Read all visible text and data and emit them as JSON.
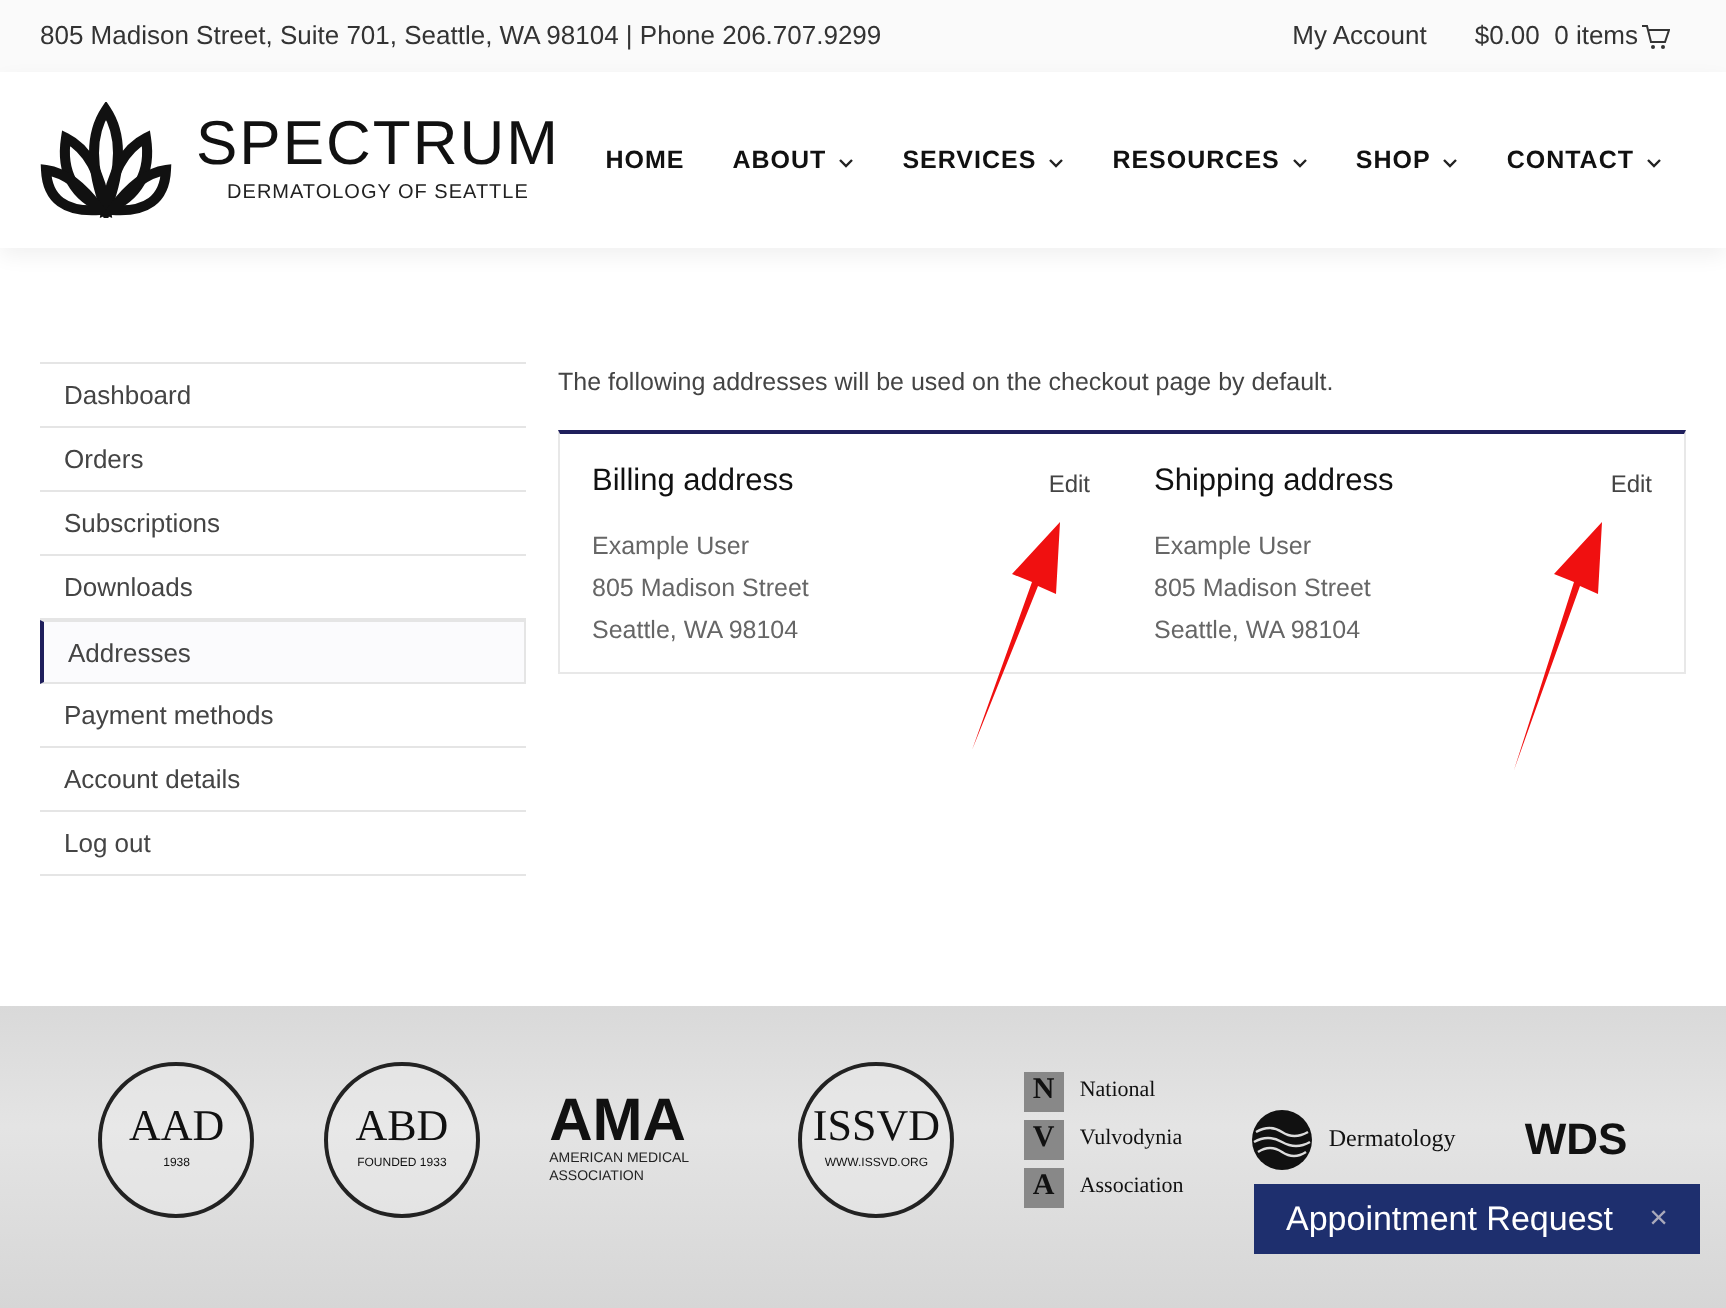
{
  "topbar": {
    "address": "805 Madison Street, Suite 701, Seattle, WA 98104 | Phone 206.707.9299",
    "account": "My Account",
    "cart": "$0.00  0 items"
  },
  "logo": {
    "name": "SPECTRUM",
    "tagline": "DERMATOLOGY OF SEATTLE"
  },
  "nav": [
    {
      "label": "HOME",
      "dropdown": false
    },
    {
      "label": "ABOUT",
      "dropdown": true
    },
    {
      "label": "SERVICES",
      "dropdown": true
    },
    {
      "label": "RESOURCES",
      "dropdown": true
    },
    {
      "label": "SHOP",
      "dropdown": true
    },
    {
      "label": "CONTACT",
      "dropdown": true
    }
  ],
  "sidebar": {
    "items": [
      {
        "label": "Dashboard",
        "selected": false
      },
      {
        "label": "Orders",
        "selected": false
      },
      {
        "label": "Subscriptions",
        "selected": false
      },
      {
        "label": "Downloads",
        "selected": false
      },
      {
        "label": "Addresses",
        "selected": true
      },
      {
        "label": "Payment methods",
        "selected": false
      },
      {
        "label": "Account details",
        "selected": false
      },
      {
        "label": "Log out",
        "selected": false
      }
    ]
  },
  "intro": "The following addresses will be used on the checkout page by default.",
  "addresses": [
    {
      "title": "Billing address",
      "edit": "Edit",
      "lines": [
        "Example User",
        "805 Madison Street",
        "Seattle, WA 98104"
      ]
    },
    {
      "title": "Shipping address",
      "edit": "Edit",
      "lines": [
        "Example User",
        "805 Madison Street",
        "Seattle, WA 98104"
      ]
    }
  ],
  "footer_logos": [
    {
      "kind": "seal",
      "text": "AAD",
      "sub": "1938"
    },
    {
      "kind": "seal",
      "text": "ABD",
      "sub": "FOUNDED 1933"
    },
    {
      "kind": "wordmark",
      "text": "AMA",
      "sub": "AMERICAN MEDICAL ASSOCIATION"
    },
    {
      "kind": "seal",
      "text": "ISSVD",
      "sub": "WWW.ISSVD.ORG"
    },
    {
      "kind": "letters",
      "rows": [
        {
          "letter": "N",
          "word": "National"
        },
        {
          "letter": "V",
          "word": "Vulvodynia"
        },
        {
          "letter": "A",
          "word": "Association"
        }
      ]
    },
    {
      "kind": "globe",
      "text": "Dermatology"
    },
    {
      "kind": "wordmark",
      "text": "WDS"
    }
  ],
  "appointment": {
    "label": "Appointment Request",
    "close": "×"
  }
}
